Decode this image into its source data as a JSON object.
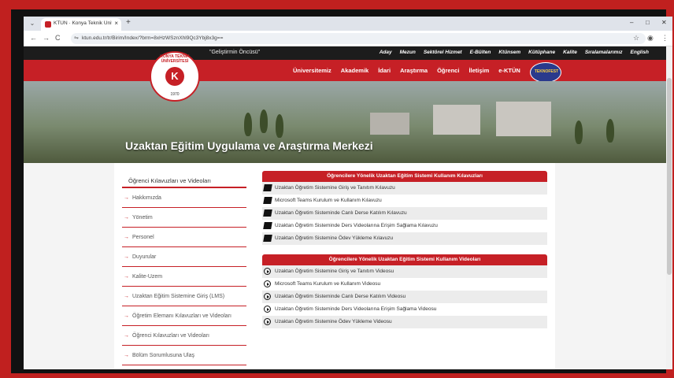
{
  "browser": {
    "tab_title": "KTÜN · Konya Teknik Üniversit...",
    "tab_close": "×",
    "new_tab": "+",
    "url": "ktun.edu.tr/tr/Birim/Index/?brm=8xHzWSznXhl9Qc3Ybj8x3g==",
    "back": "←",
    "forward": "→",
    "reload": "C",
    "min": "–",
    "max": "□",
    "close": "✕",
    "star": "☆",
    "profile": "◉",
    "menu": "⋮"
  },
  "site": {
    "tagline": "\"Geliştirmin Öncüsü\"",
    "top_links": [
      "Aday",
      "Mezun",
      "Sektörel Hizmet",
      "E-Bülten",
      "Ktünsem",
      "Kütüphane",
      "Kalite",
      "Sıralamalarımız",
      "English"
    ],
    "main_links": [
      "Üniversitemiz",
      "Akademik",
      "İdari",
      "Araştırma",
      "Öğrenci",
      "İletişim",
      "e-KTÜN"
    ],
    "badge_text": "TEKNOFEST",
    "logo": {
      "ring": "KONYA TEKNİK ÜNİVERSİTESİ",
      "letter": "K",
      "year": "1970"
    },
    "hero_title": "Uzaktan Eğitim Uygulama ve Araştırma Merkezi"
  },
  "sidebar": {
    "heading": "Öğrenci Kılavuzları ve Videoları",
    "items": [
      "Hakkımızda",
      "Yönetim",
      "Personel",
      "Duyurular",
      "Kalite-Uzem",
      "Uzaktan Eğitim Sistemine Giriş (LMS)",
      "Öğretim Elemanı Kılavuzları ve Videoları",
      "Öğrenci Kılavuzları ve Videoları",
      "Bölüm Sorumlusuna Ulaş"
    ]
  },
  "guides": {
    "title": "Öğrencilere Yönelik Uzaktan Eğitim Sistemi Kullanım Kılavuzları",
    "items": [
      "Uzaktan Öğretim Sistemine Giriş ve Tanıtım Kılavuzu",
      "Microsoft Teams Kurulum ve Kullanım Kılavuzu",
      "Uzaktan Öğretim Sisteminde Canlı Derse Katılım Kılavuzu",
      "Uzaktan Öğretim Sisteminde Ders Videolarına Erişim Sağlama Kılavuzu",
      "Uzaktan Öğretim Sistemine Ödev Yükleme Kılavuzu"
    ]
  },
  "videos": {
    "title": "Öğrencilere Yönelik Uzaktan Eğitim Sistemi Kullanım Videoları",
    "items": [
      "Uzaktan Öğretim Sistemine Giriş ve Tanıtım Videosu",
      "Microsoft Teams Kurulum ve Kullanım Videosu",
      "Uzaktan Öğretim Sisteminde Canlı Derse Katılım Videosu",
      "Uzaktan Öğretim Sisteminde Ders Videolarına Erişim Sağlama Videosu",
      "Uzaktan Öğretim Sistemine Ödev Yükleme Videosu"
    ]
  },
  "colors": {
    "brand_red": "#c62026",
    "dark": "#1c1c1c"
  }
}
